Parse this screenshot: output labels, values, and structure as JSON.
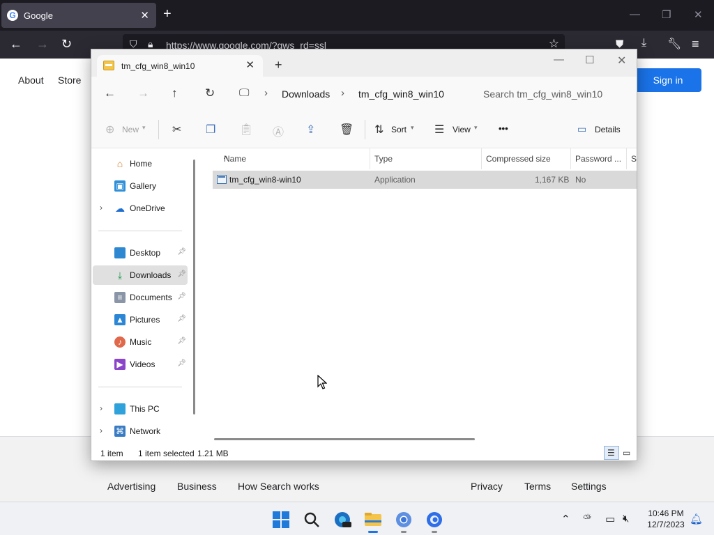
{
  "browser": {
    "tab_title": "Google",
    "tab_favicon": "G",
    "url": "https://www.google.com/?gws_rd=ssl"
  },
  "google": {
    "links": {
      "about": "About",
      "store": "Store"
    },
    "signin": "Sign in",
    "footer": {
      "advertising": "Advertising",
      "business": "Business",
      "how_search_works": "How Search works",
      "privacy": "Privacy",
      "terms": "Terms",
      "settings": "Settings"
    }
  },
  "explorer": {
    "tab_title": "tm_cfg_win8_win10",
    "breadcrumb": [
      "Downloads",
      "tm_cfg_win8_win10"
    ],
    "search_placeholder": "Search tm_cfg_win8_win10",
    "commands": {
      "new": "New",
      "sort": "Sort",
      "view": "View",
      "more": "•••",
      "details": "Details"
    },
    "nav": {
      "home": "Home",
      "gallery": "Gallery",
      "onedrive": "OneDrive",
      "desktop": "Desktop",
      "downloads": "Downloads",
      "documents": "Documents",
      "pictures": "Pictures",
      "music": "Music",
      "videos": "Videos",
      "thispc": "This PC",
      "network": "Network"
    },
    "columns": {
      "name": "Name",
      "type": "Type",
      "compressed_size": "Compressed size",
      "password": "Password ...",
      "size": "Si"
    },
    "file": {
      "name": "tm_cfg_win8-win10",
      "type": "Application",
      "compressed_size": "1,167 KB",
      "password": "No"
    },
    "status": {
      "count": "1 item",
      "selected": "1 item selected",
      "size": "1.21 MB"
    }
  },
  "taskbar": {
    "time": "10:46 PM",
    "date": "12/7/2023"
  },
  "colors": {
    "accent": "#1a73e8",
    "folder": "#f4c54a",
    "selection": "#d9d9d9"
  }
}
